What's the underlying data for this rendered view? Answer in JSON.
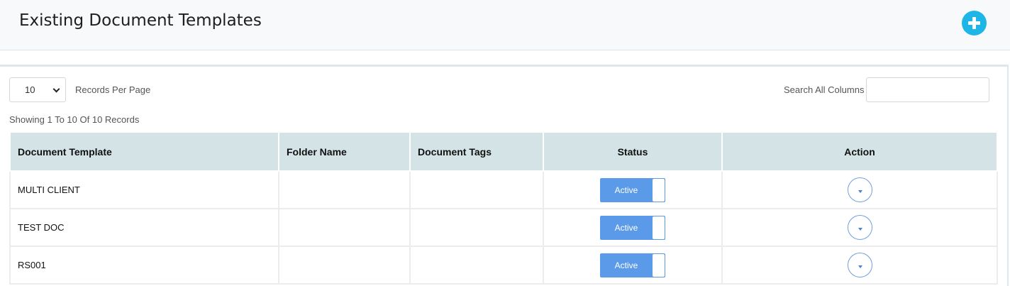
{
  "header": {
    "title": "Existing Document Templates",
    "add_icon": "plus-circle-icon",
    "accent": "#1fb5e6"
  },
  "controls": {
    "records_per_page_value": "10",
    "records_per_page_label": "Records Per Page",
    "search_label": "Search All Columns",
    "search_value": "",
    "showing_text": "Showing 1 To 10 Of 10 Records"
  },
  "table": {
    "columns": [
      "Document Template",
      "Folder Name",
      "Document Tags",
      "Status",
      "Action"
    ],
    "rows": [
      {
        "template": "MULTI CLIENT",
        "folder": "",
        "tags": "",
        "status": "Active"
      },
      {
        "template": "TEST DOC",
        "folder": "",
        "tags": "",
        "status": "Active"
      },
      {
        "template": "RS001",
        "folder": "",
        "tags": "",
        "status": "Active"
      }
    ],
    "status_color": "#5b9ae8",
    "header_bg": "#d3e3e6"
  }
}
